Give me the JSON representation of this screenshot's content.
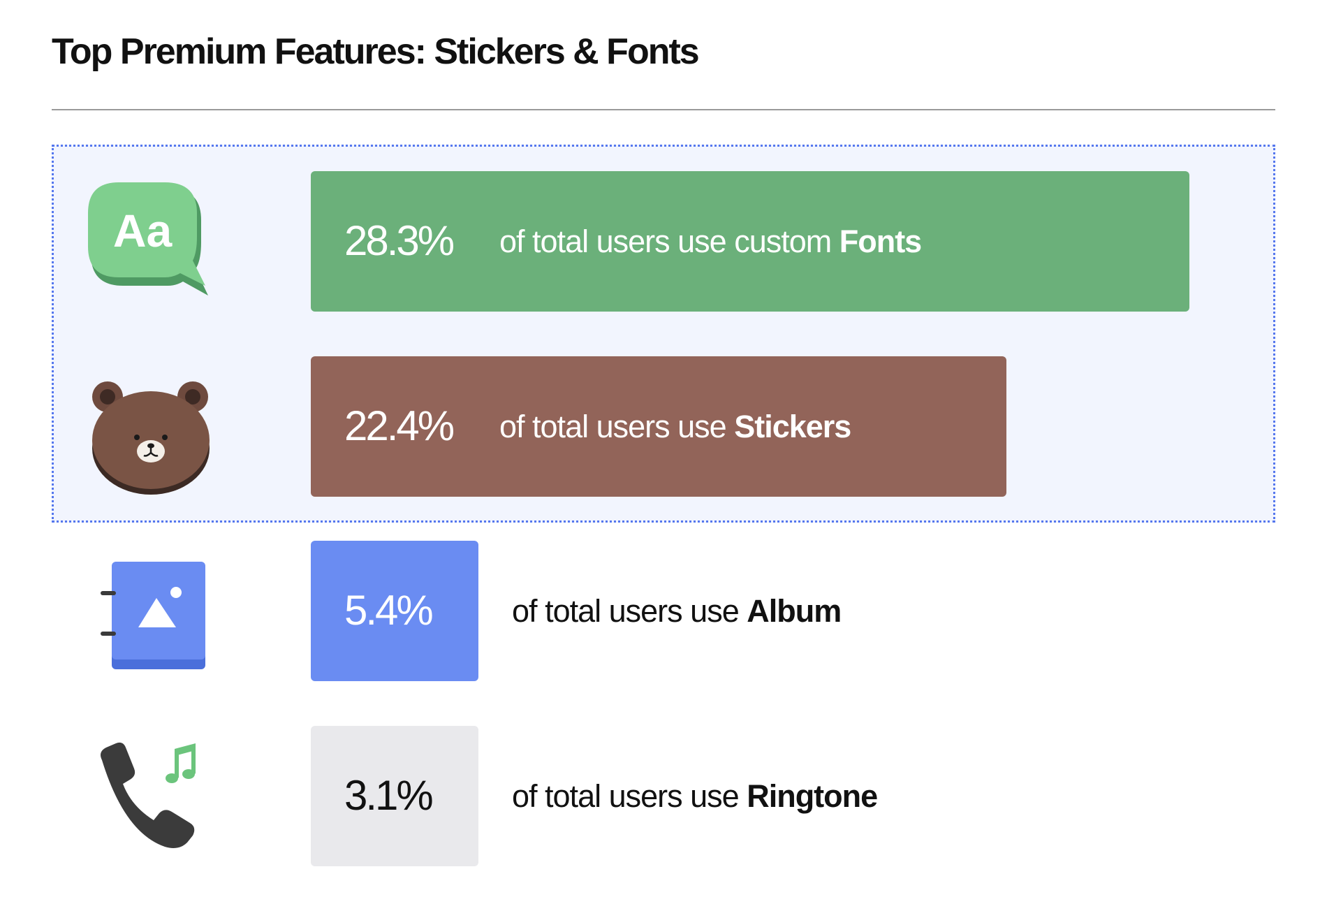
{
  "chart_data": {
    "type": "bar",
    "orientation": "horizontal",
    "title": "Top Premium Features: Stickers & Fonts",
    "unit": "%",
    "highlighted": [
      "Fonts",
      "Stickers"
    ],
    "bars": [
      {
        "feature": "Fonts",
        "value": 28.3,
        "value_label": "28.3%",
        "caption_prefix": "of total users use custom",
        "caption_bold": "Fonts",
        "color": "#6bb07a",
        "text_color": "#ffffff",
        "icon": "font-aa-icon"
      },
      {
        "feature": "Stickers",
        "value": 22.4,
        "value_label": "22.4%",
        "caption_prefix": "of total users use",
        "caption_bold": "Stickers",
        "color": "#926459",
        "text_color": "#ffffff",
        "icon": "bear-sticker-icon"
      },
      {
        "feature": "Album",
        "value": 5.4,
        "value_label": "5.4%",
        "caption_prefix": "of total users use",
        "caption_bold": "Album",
        "color": "#6a8cf2",
        "text_color": "#ffffff",
        "icon": "album-icon"
      },
      {
        "feature": "Ringtone",
        "value": 3.1,
        "value_label": "3.1%",
        "caption_prefix": "of total users use",
        "caption_bold": "Ringtone",
        "color": "#e9e9ec",
        "text_color": "#111111",
        "icon": "ringtone-icon"
      }
    ]
  }
}
